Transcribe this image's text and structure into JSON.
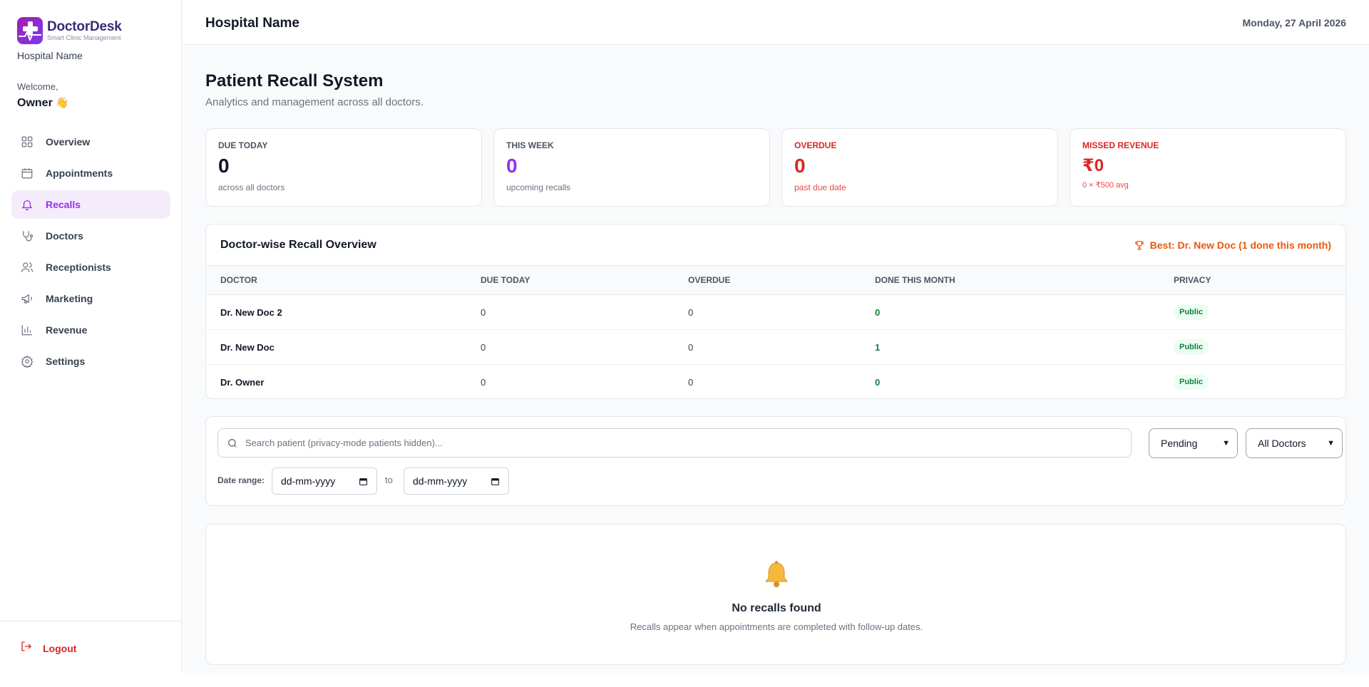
{
  "brand": {
    "name": "DoctorDesk",
    "tagline": "Smart Clinic Management"
  },
  "sidebar": {
    "hospital_name": "Hospital Name",
    "welcome": "Welcome,",
    "user": "Owner",
    "user_emoji": "👋",
    "items": [
      {
        "label": "Overview",
        "icon": "grid-icon"
      },
      {
        "label": "Appointments",
        "icon": "calendar-icon"
      },
      {
        "label": "Recalls",
        "icon": "bell-icon",
        "active": true
      },
      {
        "label": "Doctors",
        "icon": "stethoscope-icon"
      },
      {
        "label": "Receptionists",
        "icon": "users-icon"
      },
      {
        "label": "Marketing",
        "icon": "megaphone-icon"
      },
      {
        "label": "Revenue",
        "icon": "bar-chart-icon"
      },
      {
        "label": "Settings",
        "icon": "gear-icon"
      }
    ],
    "logout": "Logout"
  },
  "header": {
    "title": "Hospital Name",
    "date": "Monday, 27 April 2026"
  },
  "page": {
    "title": "Patient Recall System",
    "subtitle": "Analytics and management across all doctors."
  },
  "stats": [
    {
      "label": "DUE TODAY",
      "value": "0",
      "sub": "across all doctors",
      "color": "#111827",
      "label_color": "#4b5563",
      "sub_color": "#6b7280"
    },
    {
      "label": "THIS WEEK",
      "value": "0",
      "sub": "upcoming recalls",
      "color": "#9333ea",
      "label_color": "#4b5563",
      "sub_color": "#6b7280"
    },
    {
      "label": "OVERDUE",
      "value": "0",
      "sub": "past due date",
      "color": "#dc2626",
      "label_color": "#dc2626",
      "sub_color": "#ef4444"
    },
    {
      "label": "MISSED REVENUE",
      "value": "₹0",
      "sub": "0 × ₹500 avg",
      "color": "#dc2626",
      "label_color": "#dc2626",
      "sub_color": "#ef4444"
    }
  ],
  "overview": {
    "title": "Doctor-wise Recall Overview",
    "best": "Best: Dr. New Doc (1 done this month)",
    "columns": [
      "DOCTOR",
      "DUE TODAY",
      "OVERDUE",
      "DONE THIS MONTH",
      "PRIVACY"
    ],
    "rows": [
      {
        "doctor": "Dr. New Doc 2",
        "due_today": "0",
        "overdue": "0",
        "done": "0",
        "privacy": "Public"
      },
      {
        "doctor": "Dr. New Doc",
        "due_today": "0",
        "overdue": "0",
        "done": "1",
        "privacy": "Public"
      },
      {
        "doctor": "Dr. Owner",
        "due_today": "0",
        "overdue": "0",
        "done": "0",
        "privacy": "Public"
      }
    ]
  },
  "filters": {
    "search_placeholder": "Search patient (privacy-mode patients hidden)...",
    "status": "Pending",
    "doctor": "All Doctors",
    "date_range_label": "Date range:",
    "from_placeholder": "dd-mm-yyyy",
    "to_label": "to",
    "to_placeholder": "dd-mm-yyyy"
  },
  "empty": {
    "title": "No recalls found",
    "subtitle": "Recalls appear when appointments are completed with follow-up dates."
  },
  "colors": {
    "accent": "#9333ea",
    "danger": "#dc2626",
    "success": "#15803d",
    "warning": "#ea580c"
  }
}
